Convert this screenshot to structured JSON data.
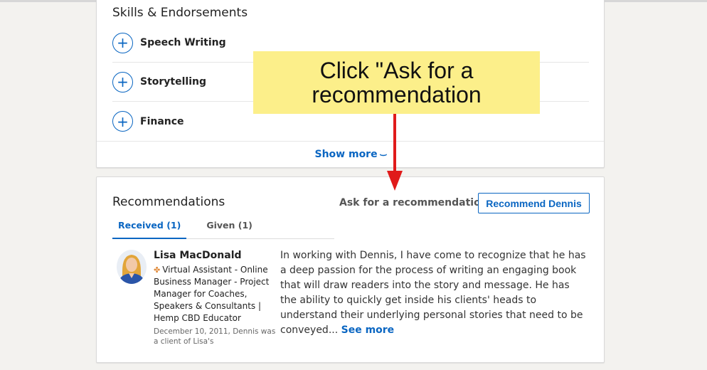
{
  "skills": {
    "title": "Skills & Endorsements",
    "items": [
      {
        "label": "Speech Writing"
      },
      {
        "label": "Storytelling"
      },
      {
        "label": "Finance"
      }
    ],
    "show_more": "Show more",
    "plus_glyph": "+"
  },
  "recommendations": {
    "title": "Recommendations",
    "ask_link": "Ask for a recommendation",
    "recommend_button": "Recommend Dennis",
    "tabs": [
      {
        "label": "Received (1)",
        "active": true
      },
      {
        "label": "Given (1)",
        "active": false
      }
    ],
    "entry": {
      "name": "Lisa MacDonald",
      "headline": "Virtual Assistant - Online Business Manager - Project Manager for Coaches, Speakers & Consultants | Hemp CBD Educator",
      "meta": "December 10, 2011, Dennis was a client of Lisa's",
      "text": "In working with Dennis, I have come to recognize that he has a deep passion for the process of writing an engaging book that will draw readers into the story and message. He has the ability to quickly get inside his clients' heads to understand their underlying personal stories that need to be conveyed...",
      "see_more": "See more"
    }
  },
  "annotation": {
    "callout_text": "Click \"Ask for a recommendation",
    "arrow_color": "#e01b1b",
    "callout_color": "#fcef8a"
  },
  "colors": {
    "accent": "#0a66c2",
    "background": "#f3f2ef"
  }
}
